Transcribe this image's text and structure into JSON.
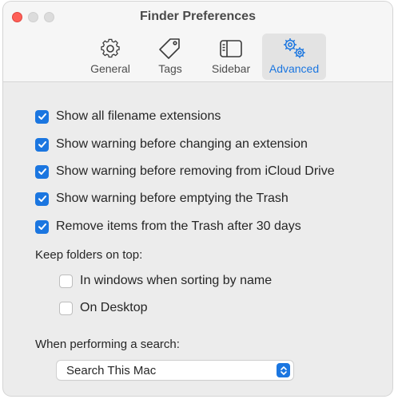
{
  "window": {
    "title": "Finder Preferences"
  },
  "tabs": [
    {
      "label": "General",
      "icon": "gear-icon",
      "active": false
    },
    {
      "label": "Tags",
      "icon": "tag-icon",
      "active": false
    },
    {
      "label": "Sidebar",
      "icon": "sidebar-icon",
      "active": false
    },
    {
      "label": "Advanced",
      "icon": "gears-icon",
      "active": true
    }
  ],
  "options": [
    {
      "label": "Show all filename extensions",
      "checked": true
    },
    {
      "label": "Show warning before changing an extension",
      "checked": true
    },
    {
      "label": "Show warning before removing from iCloud Drive",
      "checked": true
    },
    {
      "label": "Show warning before emptying the Trash",
      "checked": true
    },
    {
      "label": "Remove items from the Trash after 30 days",
      "checked": true
    }
  ],
  "folders_on_top": {
    "label": "Keep folders on top:",
    "options": [
      {
        "label": "In windows when sorting by name",
        "checked": false
      },
      {
        "label": "On Desktop",
        "checked": false
      }
    ]
  },
  "search": {
    "label": "When performing a search:",
    "selected": "Search This Mac"
  },
  "colors": {
    "accent": "#1b76e0",
    "close": "#fe5f57"
  }
}
